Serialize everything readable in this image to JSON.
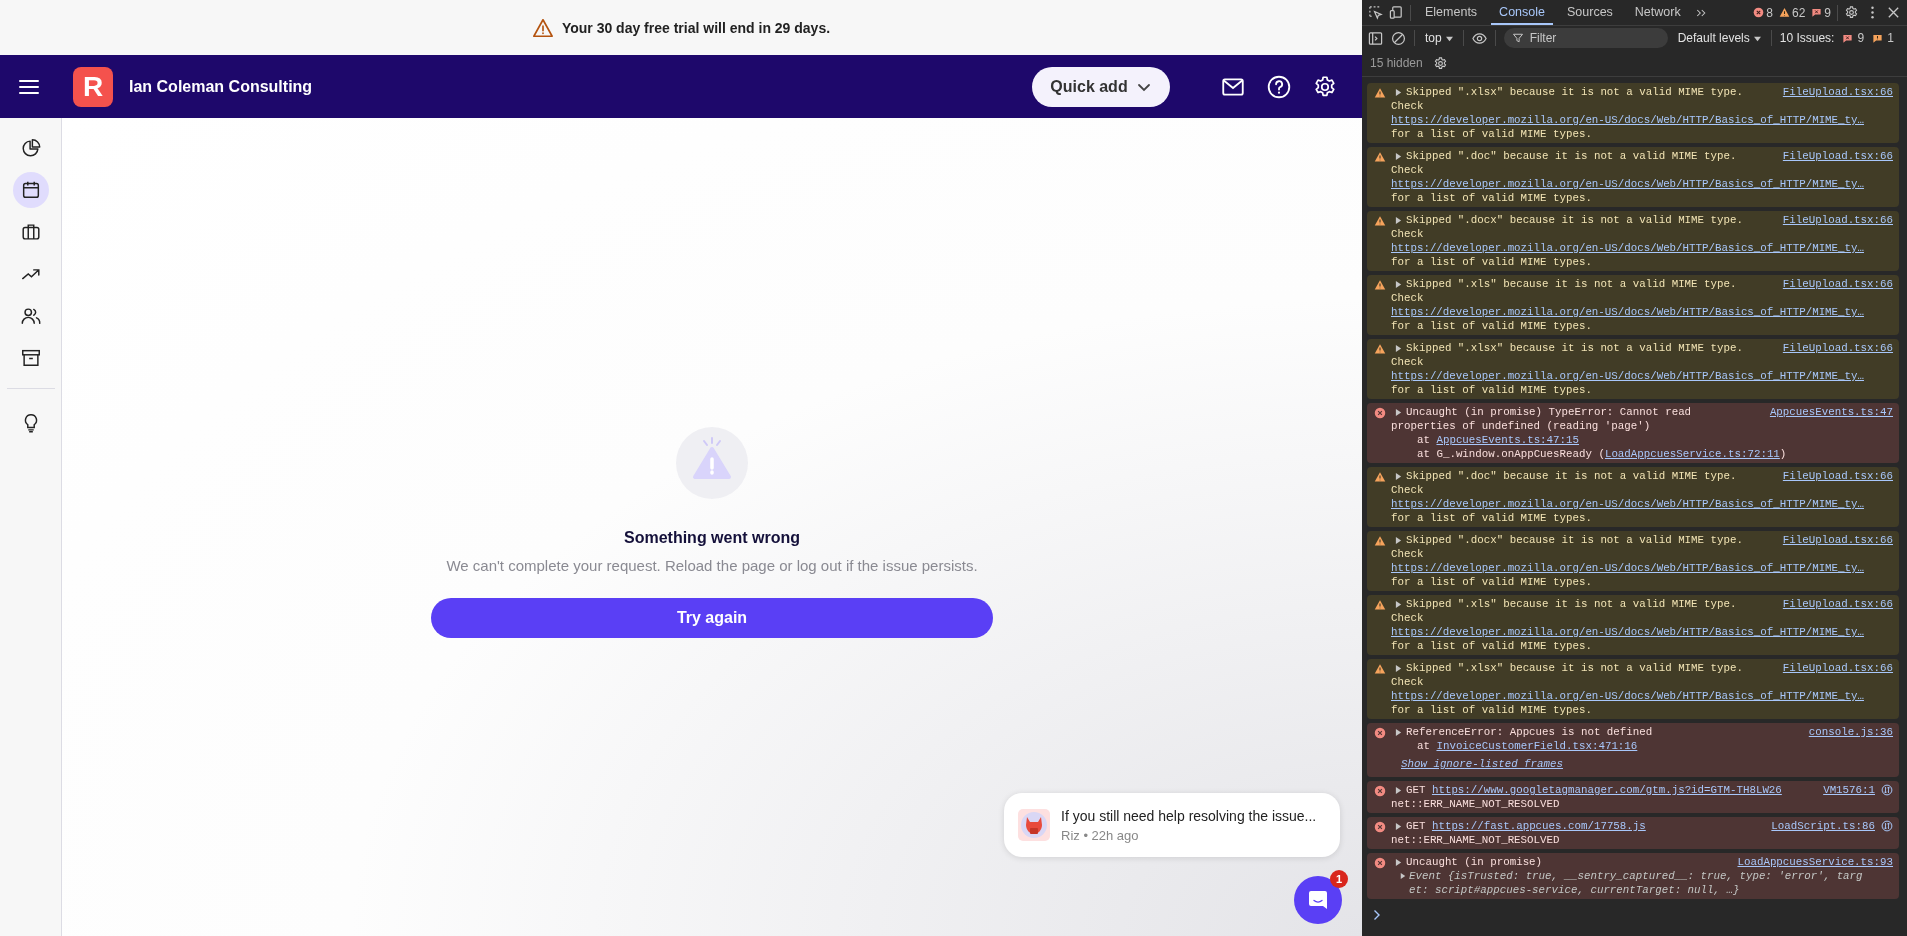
{
  "trial_banner": {
    "text": "Your 30 day free trial will end in 29 days."
  },
  "header": {
    "logo_letter": "R",
    "company": "Ian Coleman Consulting",
    "quick_add": "Quick add"
  },
  "sidebar": {
    "items": [
      {
        "kind": "chart",
        "selected": false
      },
      {
        "kind": "calendar",
        "selected": true
      },
      {
        "kind": "briefcase",
        "selected": false
      },
      {
        "kind": "trend",
        "selected": false
      },
      {
        "kind": "people",
        "selected": false
      },
      {
        "kind": "archive",
        "selected": false
      }
    ],
    "bottom_items": [
      {
        "kind": "bulb",
        "selected": false
      }
    ]
  },
  "error_state": {
    "title": "Something went wrong",
    "message": "We can't complete your request. Reload the page or log out if the issue persists.",
    "button": "Try again"
  },
  "chat": {
    "message": "If you still need help resolving the issue...",
    "meta": "Riz • 22h ago",
    "unread": "1"
  },
  "devtools": {
    "tabs": [
      {
        "label": "Elements",
        "selected": false
      },
      {
        "label": "Console",
        "selected": true
      },
      {
        "label": "Sources",
        "selected": false
      },
      {
        "label": "Network",
        "selected": false
      }
    ],
    "counts": {
      "errors": "8",
      "warnings": "62",
      "issues": "9"
    },
    "toolbar": {
      "context": "top",
      "filter_placeholder": "Filter",
      "levels": "Default levels",
      "issues_label": "10 Issues:",
      "issues_errors": "9",
      "issues_warnings": "1"
    },
    "hidden": "15 hidden",
    "messages": [
      {
        "kind": "warning",
        "text": "Skipped \".xlsx\" because it is not a valid MIME type.",
        "source": "FileUpload.tsx:66",
        "lines": [
          {
            "kind": "text",
            "text": "Check"
          },
          {
            "kind": "link",
            "text": "https://developer.mozilla.org/en-US/docs/Web/HTTP/Basics_of_HTTP/MIME_ty…"
          },
          {
            "kind": "text",
            "text": "for a list of valid MIME types."
          }
        ]
      },
      {
        "kind": "warning",
        "text": "Skipped \".doc\" because it is not a valid MIME type.",
        "source": "FileUpload.tsx:66",
        "lines": [
          {
            "kind": "text",
            "text": "Check"
          },
          {
            "kind": "link",
            "text": "https://developer.mozilla.org/en-US/docs/Web/HTTP/Basics_of_HTTP/MIME_ty…"
          },
          {
            "kind": "text",
            "text": "for a list of valid MIME types."
          }
        ]
      },
      {
        "kind": "warning",
        "text": "Skipped \".docx\" because it is not a valid MIME type.",
        "source": "FileUpload.tsx:66",
        "lines": [
          {
            "kind": "text",
            "text": "Check"
          },
          {
            "kind": "link",
            "text": "https://developer.mozilla.org/en-US/docs/Web/HTTP/Basics_of_HTTP/MIME_ty…"
          },
          {
            "kind": "text",
            "text": "for a list of valid MIME types."
          }
        ]
      },
      {
        "kind": "warning",
        "text": "Skipped \".xls\" because it is not a valid MIME type.",
        "source": "FileUpload.tsx:66",
        "lines": [
          {
            "kind": "text",
            "text": "Check"
          },
          {
            "kind": "link",
            "text": "https://developer.mozilla.org/en-US/docs/Web/HTTP/Basics_of_HTTP/MIME_ty…"
          },
          {
            "kind": "text",
            "text": "for a list of valid MIME types."
          }
        ]
      },
      {
        "kind": "warning",
        "text": "Skipped \".xlsx\" because it is not a valid MIME type.",
        "source": "FileUpload.tsx:66",
        "lines": [
          {
            "kind": "text",
            "text": "Check"
          },
          {
            "kind": "link",
            "text": "https://developer.mozilla.org/en-US/docs/Web/HTTP/Basics_of_HTTP/MIME_ty…"
          },
          {
            "kind": "text",
            "text": "for a list of valid MIME types."
          }
        ]
      },
      {
        "kind": "error",
        "text": "Uncaught (in promise) TypeError: Cannot read",
        "source": "AppcuesEvents.ts:47",
        "lines": [
          {
            "kind": "text",
            "text": "properties of undefined (reading 'page')"
          },
          {
            "kind": "stack",
            "prefix": "at ",
            "link": "AppcuesEvents.ts:47:15"
          },
          {
            "kind": "stack",
            "prefix": "at G_.window.onAppCuesReady (",
            "link": "LoadAppcuesService.ts:72:11",
            "suffix": ")"
          }
        ]
      },
      {
        "kind": "warning",
        "text": "Skipped \".doc\" because it is not a valid MIME type.",
        "source": "FileUpload.tsx:66",
        "lines": [
          {
            "kind": "text",
            "text": "Check"
          },
          {
            "kind": "link",
            "text": "https://developer.mozilla.org/en-US/docs/Web/HTTP/Basics_of_HTTP/MIME_ty…"
          },
          {
            "kind": "text",
            "text": "for a list of valid MIME types."
          }
        ]
      },
      {
        "kind": "warning",
        "text": "Skipped \".docx\" because it is not a valid MIME type.",
        "source": "FileUpload.tsx:66",
        "lines": [
          {
            "kind": "text",
            "text": "Check"
          },
          {
            "kind": "link",
            "text": "https://developer.mozilla.org/en-US/docs/Web/HTTP/Basics_of_HTTP/MIME_ty…"
          },
          {
            "kind": "text",
            "text": "for a list of valid MIME types."
          }
        ]
      },
      {
        "kind": "warning",
        "text": "Skipped \".xls\" because it is not a valid MIME type.",
        "source": "FileUpload.tsx:66",
        "lines": [
          {
            "kind": "text",
            "text": "Check"
          },
          {
            "kind": "link",
            "text": "https://developer.mozilla.org/en-US/docs/Web/HTTP/Basics_of_HTTP/MIME_ty…"
          },
          {
            "kind": "text",
            "text": "for a list of valid MIME types."
          }
        ]
      },
      {
        "kind": "warning",
        "text": "Skipped \".xlsx\" because it is not a valid MIME type.",
        "source": "FileUpload.tsx:66",
        "lines": [
          {
            "kind": "text",
            "text": "Check"
          },
          {
            "kind": "link",
            "text": "https://developer.mozilla.org/en-US/docs/Web/HTTP/Basics_of_HTTP/MIME_ty…"
          },
          {
            "kind": "text",
            "text": "for a list of valid MIME types."
          }
        ]
      },
      {
        "kind": "error",
        "text": "ReferenceError: Appcues is not defined",
        "source": "console.js:36",
        "lines": [
          {
            "kind": "stack",
            "prefix": "at ",
            "link": "InvoiceCustomerField.tsx:471:16"
          },
          {
            "kind": "toggle",
            "text": "Show ignore-listed frames"
          }
        ]
      },
      {
        "kind": "error",
        "text": "GET",
        "url": "https://www.googletagmanager.com/gtm.js?id=GTM-TH8LW26",
        "source": "VM1576:1",
        "network": true,
        "lines": [
          {
            "kind": "text",
            "text": "net::ERR_NAME_NOT_RESOLVED"
          }
        ]
      },
      {
        "kind": "error",
        "text": "GET",
        "url": "https://fast.appcues.com/17758.js",
        "source": "LoadScript.ts:86",
        "network": true,
        "lines": [
          {
            "kind": "text",
            "text": "net::ERR_NAME_NOT_RESOLVED"
          }
        ]
      },
      {
        "kind": "error",
        "text": "Uncaught (in promise)",
        "source": "LoadAppcuesService.ts:93",
        "lines": [
          {
            "kind": "object",
            "expandable": true,
            "text": "Event {isTrusted: true, __sentry_captured__: true, type: 'error', targ"
          },
          {
            "kind": "object",
            "expandable": false,
            "text": "et: script#appcues-service, currentTarget: null, …}"
          }
        ]
      }
    ]
  }
}
